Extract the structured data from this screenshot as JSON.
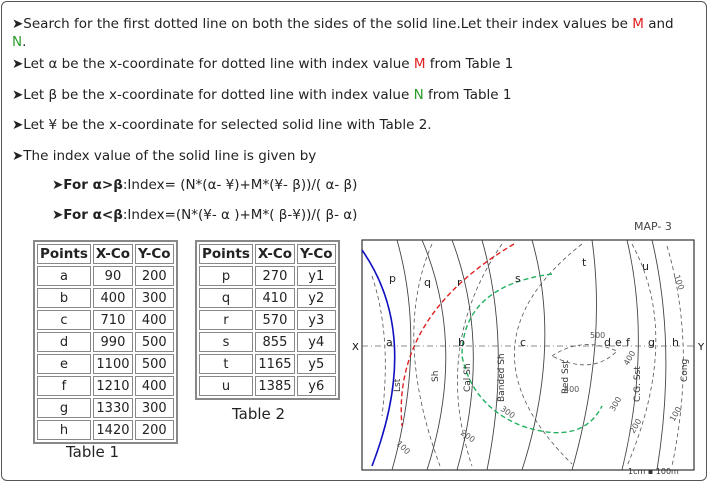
{
  "instructions": {
    "line1a": "➤Search for the first dotted line on both the sides of the solid line.Let their index values be ",
    "M": "M",
    "and": " and",
    "N": "N",
    "dot": ".",
    "line2a": "➤Let α be the x-coordinate for dotted line with index value ",
    "line2b": " from Table 1",
    "line3a": "➤Let β be the x-coordinate for dotted line with index value ",
    "line3b": " from Table 1",
    "line4": "➤Let ¥ be the x-coordinate for selected solid line with Table 2.",
    "line5": "➤The index value of the solid line is given by"
  },
  "formulas": {
    "f1_label": "➤For α>β",
    "f1_text": ":Index= (N*(α- ¥)+M*(¥- β))/( α- β)",
    "f2_label": "➤For α<β",
    "f2_text": ":Index=(N*(¥- α )+M*( β-¥))/( β- α)"
  },
  "table1": {
    "headers": [
      "Points",
      "X-Co",
      "Y-Co"
    ],
    "rows": [
      [
        "a",
        "90",
        "200"
      ],
      [
        "b",
        "400",
        "300"
      ],
      [
        "c",
        "710",
        "400"
      ],
      [
        "d",
        "990",
        "500"
      ],
      [
        "e",
        "1100",
        "500"
      ],
      [
        "f",
        "1210",
        "400"
      ],
      [
        "g",
        "1330",
        "300"
      ],
      [
        "h",
        "1420",
        "200"
      ]
    ],
    "caption": "Table 1"
  },
  "table2": {
    "headers": [
      "Points",
      "X-Co",
      "Y-Co"
    ],
    "rows": [
      [
        "p",
        "270",
        "y1"
      ],
      [
        "q",
        "410",
        "y2"
      ],
      [
        "r",
        "570",
        "y3"
      ],
      [
        "s",
        "855",
        "y4"
      ],
      [
        "t",
        "1165",
        "y5"
      ],
      [
        "u",
        "1385",
        "y6"
      ]
    ],
    "caption": "Table 2"
  },
  "map": {
    "title": "MAP- 3",
    "axis_x_left": "X",
    "axis_x_right": "Y",
    "top_points": [
      "p",
      "q",
      "r",
      "s",
      "t",
      "u"
    ],
    "axis_points": [
      "a",
      "b",
      "c",
      "d",
      "e",
      "f",
      "g",
      "h"
    ],
    "rock_labels": [
      "Lst",
      "Sh",
      "Cal Sh",
      "Banded Sh",
      "Red Sst",
      "C.G. Sst",
      "Cong"
    ],
    "contour_labels": [
      "100",
      "200",
      "300",
      "400",
      "500",
      "400",
      "300",
      "200",
      "100",
      "100"
    ],
    "scale": "1cm  ▪ 100m",
    "colors": {
      "red": "#e02020",
      "green": "#22b060",
      "blue": "#1010c0"
    }
  }
}
